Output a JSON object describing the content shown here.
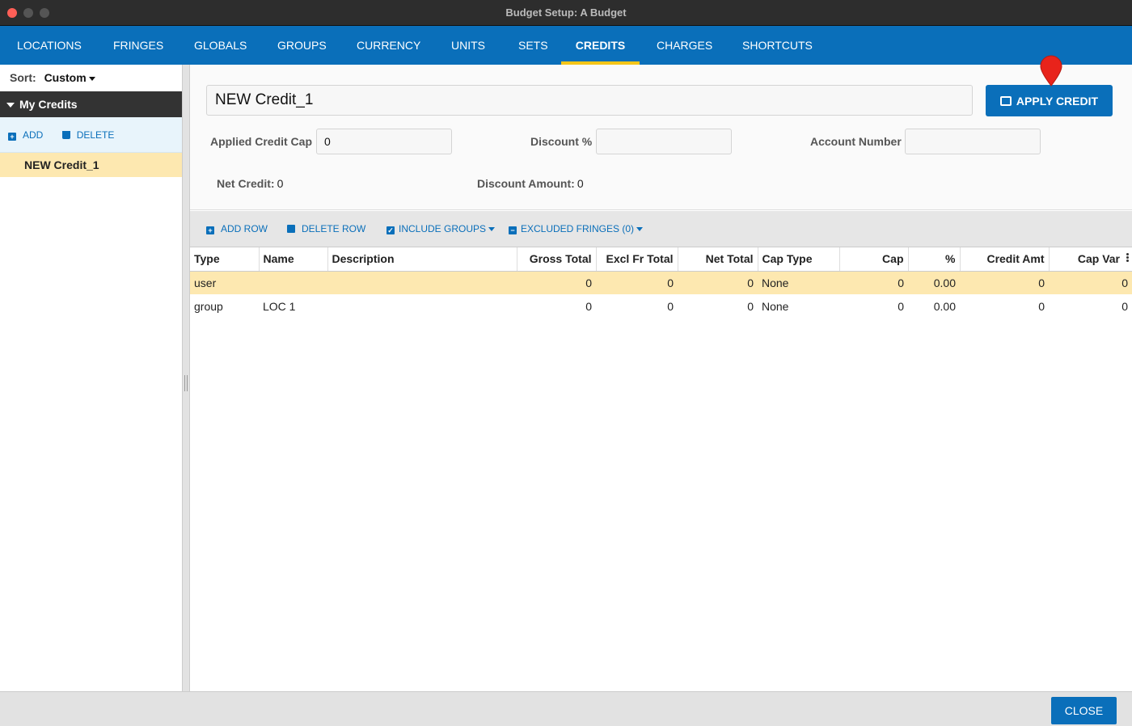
{
  "window": {
    "title": "Budget Setup: A Budget"
  },
  "nav": {
    "tabs": [
      {
        "label": "LOCATIONS"
      },
      {
        "label": "FRINGES"
      },
      {
        "label": "GLOBALS"
      },
      {
        "label": "GROUPS"
      },
      {
        "label": "CURRENCY"
      },
      {
        "label": "UNITS"
      },
      {
        "label": "SETS"
      },
      {
        "label": "CREDITS",
        "active": true
      },
      {
        "label": "CHARGES"
      },
      {
        "label": "SHORTCUTS"
      }
    ],
    "accent_color": "#f5c518",
    "bar_color": "#0a6fba"
  },
  "sidebar": {
    "sort_label": "Sort:",
    "sort_value": "Custom",
    "group_label": "My Credits",
    "add_label": "ADD",
    "delete_label": "DELETE",
    "items": [
      {
        "label": "NEW Credit_1",
        "selected": true
      }
    ]
  },
  "form": {
    "name_value": "NEW Credit_1",
    "apply_label": "APPLY CREDIT",
    "applied_credit_cap_label": "Applied Credit Cap",
    "applied_credit_cap_value": "0",
    "discount_label": "Discount %",
    "discount_value": "",
    "account_number_label": "Account Number",
    "account_number_value": "",
    "net_credit_label": "Net Credit:",
    "net_credit_value": "0",
    "discount_amount_label": "Discount Amount:",
    "discount_amount_value": "0"
  },
  "toolbar": {
    "add_row": "ADD ROW",
    "delete_row": "DELETE ROW",
    "include_groups": "INCLUDE GROUPS",
    "excluded_fringes": "EXCLUDED FRINGES (0)"
  },
  "table": {
    "columns": [
      "Type",
      "Name",
      "Description",
      "Gross Total",
      "Excl Fr Total",
      "Net Total",
      "Cap Type",
      "Cap",
      "%",
      "Credit Amt",
      "Cap Var"
    ],
    "rows": [
      [
        "user",
        "",
        "",
        "0",
        "0",
        "0",
        "None",
        "0",
        "0.00",
        "0",
        "0"
      ],
      [
        "group",
        "LOC 1",
        "",
        "0",
        "0",
        "0",
        "None",
        "0",
        "0.00",
        "0",
        "0"
      ]
    ]
  },
  "footer": {
    "close_label": "CLOSE"
  }
}
